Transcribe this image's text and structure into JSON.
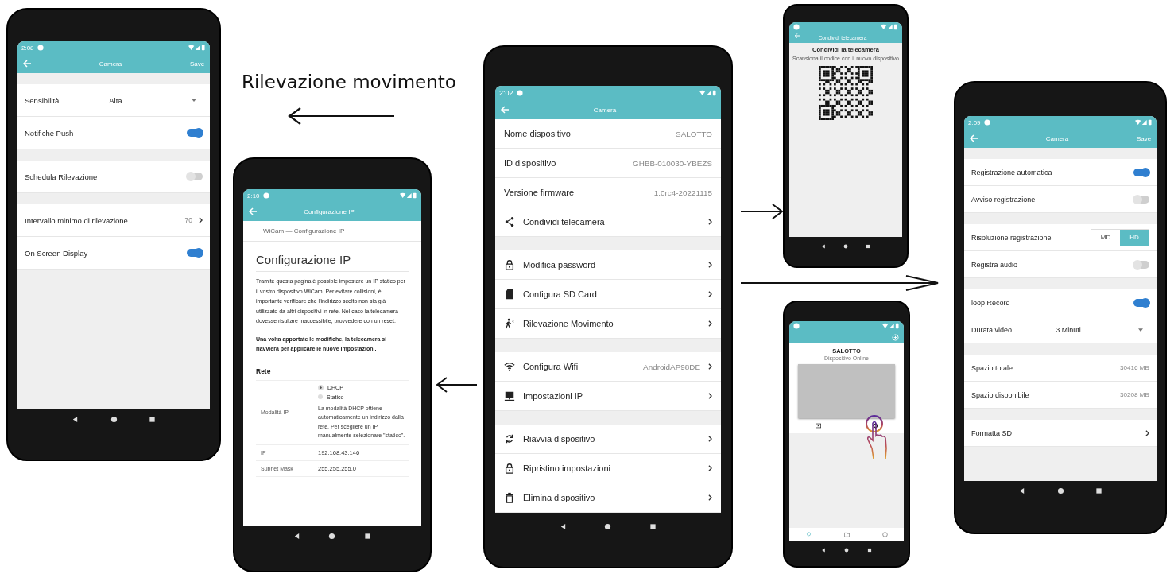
{
  "caption": "Rilevazione movimento",
  "motion_screen": {
    "time": "2:08",
    "title": "Camera",
    "action": "Save",
    "sections": [
      {
        "rows": [
          {
            "kind": "select",
            "label": "Sensibilità",
            "value": "Alta"
          },
          {
            "kind": "toggle",
            "label": "Notifiche Push",
            "on": true
          }
        ]
      },
      {
        "rows": [
          {
            "kind": "toggle",
            "label": "Schedula Rilevazione",
            "on": false
          }
        ]
      },
      {
        "rows": [
          {
            "kind": "link",
            "label": "Intervallo minimo di rilevazione",
            "value": "70"
          },
          {
            "kind": "toggle",
            "label": "On Screen Display",
            "on": true
          }
        ]
      }
    ]
  },
  "ip_screen": {
    "time": "2:10",
    "title": "Configurazione IP",
    "breadcrumb": "WiCam — Configurazione IP",
    "heading": "Configurazione IP",
    "intro": "Tramite questa pagina è possible impostare un IP statico per il vostro dispositivo WiCam. Per evitare collisioni, è importante verificare che l'indirizzo scelto non sia già utilizzato da altri dispositivi in rete. Nel caso la telecamera dovesse risultare inaccessibile, provvedere con un reset.",
    "note": "Una volta apportate le modifiche, la telecamera si riavvierà per applicare le nuove impostazioni.",
    "section": "Rete",
    "mode": {
      "label": "Modalità IP",
      "options": [
        {
          "label": "DHCP",
          "selected": true
        },
        {
          "label": "Statico",
          "selected": false
        }
      ],
      "help": "La modalità DHCP ottiene automaticamente un indirizzo dalla rete. Per scegliere un IP manualmente selezionare \"statico\"."
    },
    "fields": [
      {
        "label": "IP",
        "value": "192.168.43.146"
      },
      {
        "label": "Subnet Mask",
        "value": "255.255.255.0"
      }
    ]
  },
  "main_screen": {
    "time": "2:02",
    "title": "Camera",
    "sections": [
      {
        "rows": [
          {
            "kind": "info",
            "label": "Nome dispositivo",
            "value": "SALOTTO"
          },
          {
            "kind": "info",
            "label": "ID dispositivo",
            "value": "GHBB-010030-YBEZS"
          },
          {
            "kind": "info",
            "label": "Versione firmware",
            "value": "1.0rc4-20221115"
          },
          {
            "kind": "link",
            "label": "Condividi telecamera"
          }
        ]
      },
      {
        "rows": [
          {
            "kind": "link",
            "label": "Modifica password"
          },
          {
            "kind": "link",
            "label": "Configura SD Card"
          },
          {
            "kind": "link",
            "label": "Rilevazione Movimento"
          }
        ]
      },
      {
        "rows": [
          {
            "kind": "link",
            "label": "Configura Wifi",
            "value": "AndroidAP98DE"
          },
          {
            "kind": "link",
            "label": "Impostazioni IP"
          }
        ]
      },
      {
        "rows": [
          {
            "kind": "link",
            "label": "Riavvia dispositivo"
          },
          {
            "kind": "link",
            "label": "Ripristino impostazioni"
          },
          {
            "kind": "link",
            "label": "Elimina dispositivo"
          }
        ]
      }
    ]
  },
  "share_screen": {
    "title": "Condividi telecamera",
    "heading": "Condividi la telecamera",
    "hint": "Scansiona il codice con il nuovo dispositivo"
  },
  "device_list_screen": {
    "device_name": "SALOTTO",
    "device_status": "Dispositivo Online",
    "bottom_tabs": [
      {
        "selected": true
      },
      {
        "selected": false
      },
      {
        "selected": false
      }
    ]
  },
  "recording_screen": {
    "time": "2:09",
    "title": "Camera",
    "action": "Save",
    "sections": [
      {
        "rows": [
          {
            "kind": "toggle",
            "label": "Registrazione automatica",
            "on": true
          },
          {
            "kind": "toggle",
            "label": "Avviso registrazione",
            "on": false
          }
        ]
      },
      {
        "rows": [
          {
            "kind": "segmented",
            "label": "Risoluzione registrazione",
            "options": [
              {
                "label": "MD",
                "selected": false
              },
              {
                "label": "HD",
                "selected": true
              }
            ]
          },
          {
            "kind": "toggle",
            "label": "Registra audio",
            "on": false
          }
        ]
      },
      {
        "rows": [
          {
            "kind": "toggle",
            "label": "loop Record",
            "on": true
          },
          {
            "kind": "select",
            "label": "Durata video",
            "value": "3 Minuti"
          }
        ]
      },
      {
        "rows": [
          {
            "kind": "info",
            "label": "Spazio totale",
            "value": "30416 MB"
          },
          {
            "kind": "info",
            "label": "Spazio disponibile",
            "value": "30208 MB"
          }
        ]
      },
      {
        "rows": [
          {
            "kind": "link",
            "label": "Formatta SD"
          }
        ]
      }
    ]
  }
}
